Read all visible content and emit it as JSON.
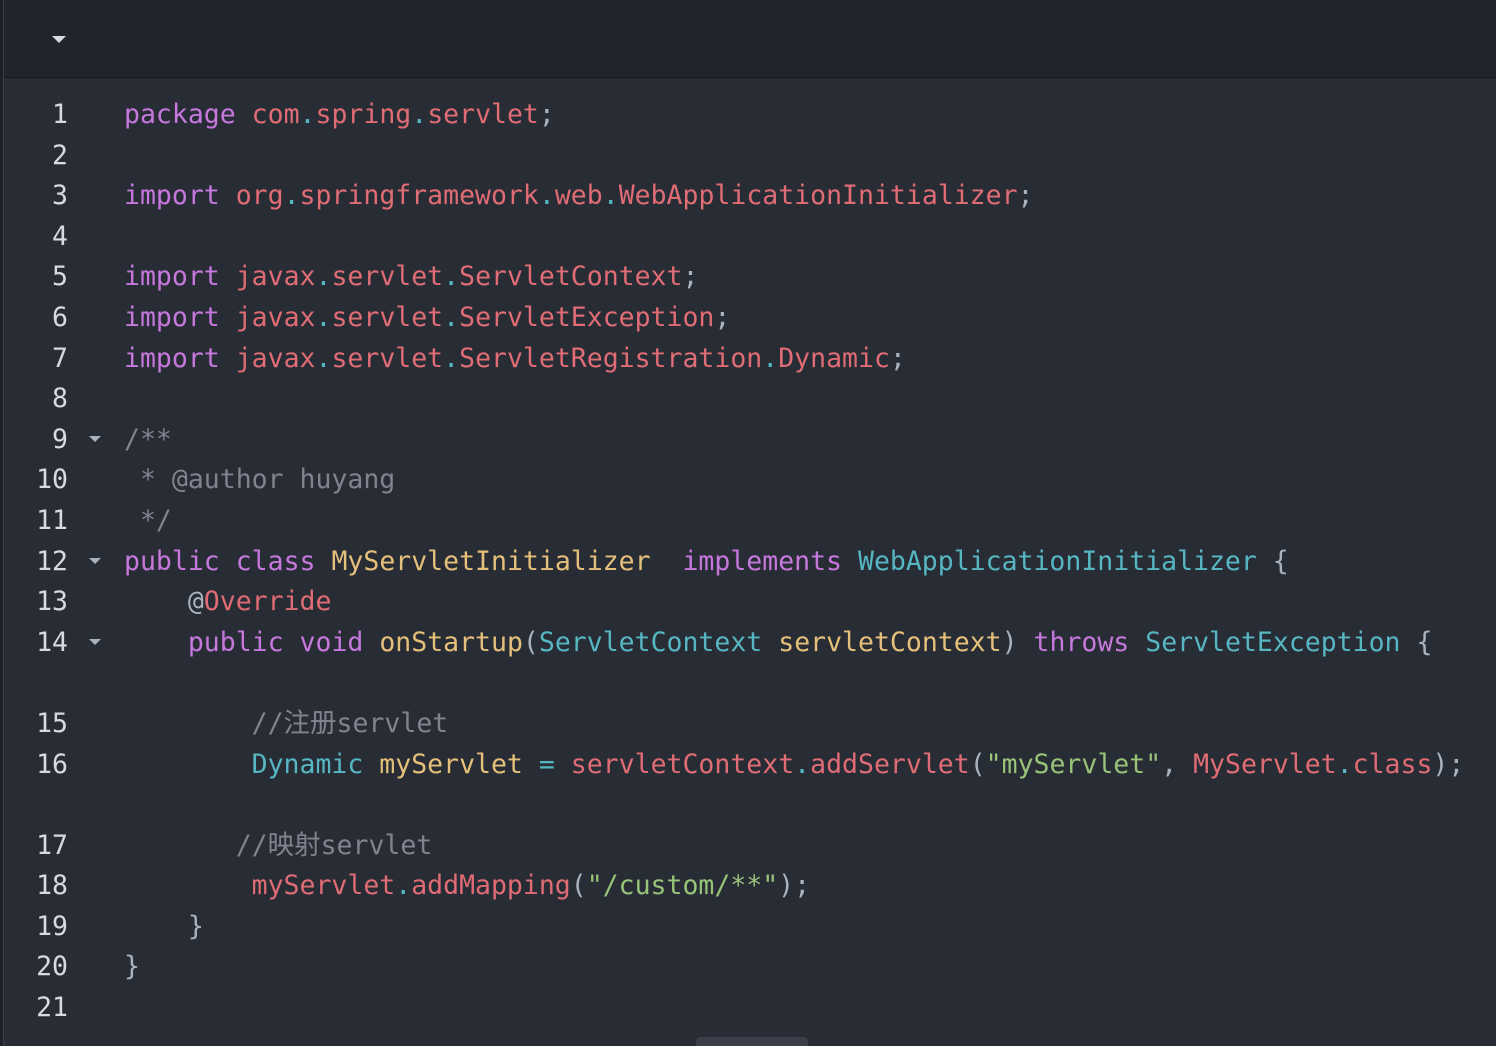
{
  "toolbar": {
    "toggle_icon": "caret-down-icon"
  },
  "colors": {
    "background": "#282c34",
    "keyword": "#c678dd",
    "namespace": "#e06c75",
    "class": "#e5c07b",
    "type": "#56b6c2",
    "string": "#98c379",
    "comment": "#7f848e",
    "plain": "#abb2bf"
  },
  "code": {
    "language": "java",
    "lines": [
      {
        "n": "1",
        "fold": false,
        "tokens": [
          [
            "kw",
            "package"
          ],
          [
            "pl",
            " "
          ],
          [
            "ns",
            "com"
          ],
          [
            "op",
            "."
          ],
          [
            "ns",
            "spring"
          ],
          [
            "op",
            "."
          ],
          [
            "ns",
            "servlet"
          ],
          [
            "pl",
            ";"
          ]
        ]
      },
      {
        "n": "2",
        "fold": false,
        "tokens": []
      },
      {
        "n": "3",
        "fold": false,
        "tokens": [
          [
            "kw",
            "import"
          ],
          [
            "pl",
            " "
          ],
          [
            "ns",
            "org"
          ],
          [
            "op",
            "."
          ],
          [
            "ns",
            "springframework"
          ],
          [
            "op",
            "."
          ],
          [
            "ns",
            "web"
          ],
          [
            "op",
            "."
          ],
          [
            "ns",
            "WebApplicationInitializer"
          ],
          [
            "pl",
            ";"
          ]
        ]
      },
      {
        "n": "4",
        "fold": false,
        "tokens": []
      },
      {
        "n": "5",
        "fold": false,
        "tokens": [
          [
            "kw",
            "import"
          ],
          [
            "pl",
            " "
          ],
          [
            "ns",
            "javax"
          ],
          [
            "op",
            "."
          ],
          [
            "ns",
            "servlet"
          ],
          [
            "op",
            "."
          ],
          [
            "ns",
            "ServletContext"
          ],
          [
            "pl",
            ";"
          ]
        ]
      },
      {
        "n": "6",
        "fold": false,
        "tokens": [
          [
            "kw",
            "import"
          ],
          [
            "pl",
            " "
          ],
          [
            "ns",
            "javax"
          ],
          [
            "op",
            "."
          ],
          [
            "ns",
            "servlet"
          ],
          [
            "op",
            "."
          ],
          [
            "ns",
            "ServletException"
          ],
          [
            "pl",
            ";"
          ]
        ]
      },
      {
        "n": "7",
        "fold": false,
        "tokens": [
          [
            "kw",
            "import"
          ],
          [
            "pl",
            " "
          ],
          [
            "ns",
            "javax"
          ],
          [
            "op",
            "."
          ],
          [
            "ns",
            "servlet"
          ],
          [
            "op",
            "."
          ],
          [
            "ns",
            "ServletRegistration"
          ],
          [
            "op",
            "."
          ],
          [
            "ns",
            "Dynamic"
          ],
          [
            "pl",
            ";"
          ]
        ]
      },
      {
        "n": "8",
        "fold": false,
        "tokens": []
      },
      {
        "n": "9",
        "fold": true,
        "tokens": [
          [
            "com",
            "/**"
          ]
        ]
      },
      {
        "n": "10",
        "fold": false,
        "tokens": [
          [
            "com",
            " * @author huyang"
          ]
        ]
      },
      {
        "n": "11",
        "fold": false,
        "tokens": [
          [
            "com",
            " */"
          ]
        ]
      },
      {
        "n": "12",
        "fold": true,
        "tokens": [
          [
            "kw",
            "public"
          ],
          [
            "pl",
            " "
          ],
          [
            "kw",
            "class"
          ],
          [
            "pl",
            " "
          ],
          [
            "cls",
            "MyServletInitializer"
          ],
          [
            "pl",
            "  "
          ],
          [
            "kw",
            "implements"
          ],
          [
            "pl",
            " "
          ],
          [
            "typ",
            "WebApplicationInitializer"
          ],
          [
            "pl",
            " {"
          ]
        ]
      },
      {
        "n": "13",
        "fold": false,
        "tokens": [
          [
            "pl",
            "    @"
          ],
          [
            "ns",
            "Override"
          ]
        ]
      },
      {
        "n": "14",
        "fold": true,
        "wrap": true,
        "tokens": [
          [
            "pl",
            "    "
          ],
          [
            "kw",
            "public"
          ],
          [
            "pl",
            " "
          ],
          [
            "kw",
            "void"
          ],
          [
            "pl",
            " "
          ],
          [
            "var",
            "onStartup"
          ],
          [
            "pl",
            "("
          ],
          [
            "typ",
            "ServletContext"
          ],
          [
            "pl",
            " "
          ],
          [
            "var",
            "servletContext"
          ],
          [
            "pl",
            ") "
          ],
          [
            "kw",
            "throws"
          ],
          [
            "pl",
            " "
          ],
          [
            "typ",
            "ServletException"
          ],
          [
            "pl",
            " {"
          ]
        ]
      },
      {
        "n": "15",
        "fold": false,
        "tokens": [
          [
            "com",
            "        //注册servlet"
          ]
        ]
      },
      {
        "n": "16",
        "fold": false,
        "wrap": true,
        "tokens": [
          [
            "pl",
            "        "
          ],
          [
            "typ",
            "Dynamic"
          ],
          [
            "pl",
            " "
          ],
          [
            "var",
            "myServlet"
          ],
          [
            "pl",
            " "
          ],
          [
            "op",
            "="
          ],
          [
            "pl",
            " "
          ],
          [
            "fn",
            "servletContext"
          ],
          [
            "op",
            "."
          ],
          [
            "fn",
            "addServlet"
          ],
          [
            "pl",
            "("
          ],
          [
            "str",
            "\"myServlet\""
          ],
          [
            "pl",
            ", "
          ],
          [
            "fn",
            "MyServlet"
          ],
          [
            "op",
            "."
          ],
          [
            "fn",
            "class"
          ],
          [
            "pl",
            ");"
          ]
        ]
      },
      {
        "n": "17",
        "fold": false,
        "tokens": [
          [
            "com",
            "       //映射servlet"
          ]
        ]
      },
      {
        "n": "18",
        "fold": false,
        "tokens": [
          [
            "pl",
            "        "
          ],
          [
            "fn",
            "myServlet"
          ],
          [
            "op",
            "."
          ],
          [
            "fn",
            "addMapping"
          ],
          [
            "pl",
            "("
          ],
          [
            "str",
            "\"/custom/**\""
          ],
          [
            "pl",
            ");"
          ]
        ]
      },
      {
        "n": "19",
        "fold": false,
        "tokens": [
          [
            "pl",
            "    }"
          ]
        ]
      },
      {
        "n": "20",
        "fold": false,
        "tokens": [
          [
            "pl",
            "}"
          ]
        ]
      },
      {
        "n": "21",
        "fold": false,
        "tokens": []
      }
    ]
  },
  "fold_icon": "caret-down-icon"
}
